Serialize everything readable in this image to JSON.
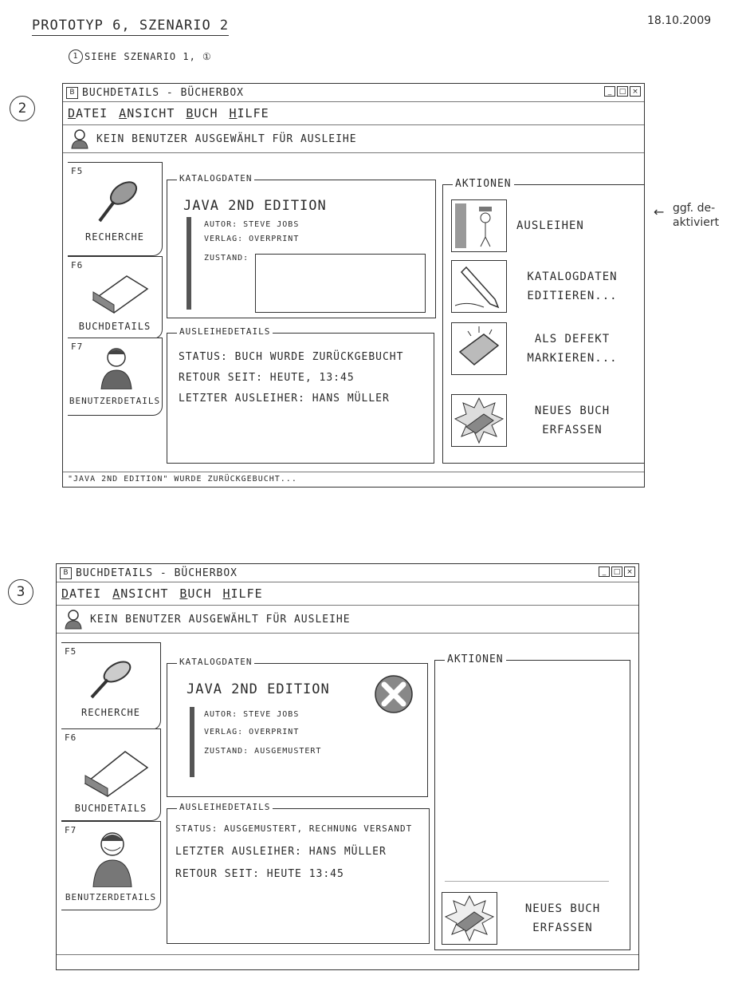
{
  "page": {
    "title": "Prototyp 6, Szenario 2",
    "date": "18.10.2009",
    "note": "siehe Szenario 1, ①",
    "note_marker": "1",
    "margin_note": "ggf. de-aktiviert",
    "arrow": "←",
    "step_2": "2",
    "step_3": "3"
  },
  "menu": [
    "Datei",
    "Ansicht",
    "Buch",
    "Hilfe"
  ],
  "window_controls": [
    "_",
    "□",
    "×"
  ],
  "tabs": [
    {
      "key": "F5",
      "label": "Recherche",
      "icon": "magnifier-icon"
    },
    {
      "key": "F6",
      "label": "Buchdetails",
      "icon": "book-icon"
    },
    {
      "key": "F7",
      "label": "Benutzerdetails",
      "icon": "user-icon"
    }
  ],
  "window1": {
    "title": "Buchdetails - BücherBox",
    "user_status": "Kein Benutzer ausgewählt für Ausleihe",
    "katalog": {
      "label": "Katalogdaten",
      "book_title": "Java 2nd Edition",
      "author": "Autor: Steve Jobs",
      "publisher": "Verlag: Overprint",
      "condition": "Zustand:"
    },
    "ausleihe": {
      "label": "Ausleihedetails",
      "status": "Status: Buch wurde zurückgebucht",
      "retour": "Retour seit: Heute, 13:45",
      "last": "Letzter Ausleiher: Hans Müller"
    },
    "actions": {
      "label": "Aktionen",
      "items": [
        {
          "label": "Ausleihen",
          "icon": "lend-icon"
        },
        {
          "label": "Katalogdaten editieren...",
          "icon": "pencil-icon"
        },
        {
          "label": "Als defekt markieren...",
          "icon": "broken-icon"
        },
        {
          "label": "Neues Buch erfassen",
          "icon": "new-book-icon"
        }
      ]
    },
    "status_bar": "\"Java 2nd Edition\" wurde zurückgebucht..."
  },
  "window2": {
    "title": "Buchdetails - BücherBox",
    "user_status": "Kein Benutzer ausgewählt für Ausleihe",
    "katalog": {
      "label": "Katalogdaten",
      "book_title": "Java 2nd Edition",
      "author": "Autor: Steve Jobs",
      "publisher": "Verlag: Overprint",
      "condition": "Zustand: Ausgemustert"
    },
    "ausleihe": {
      "label": "Ausleihedetails",
      "status": "Status: Ausgemustert, Rechnung versandt",
      "last": "Letzter Ausleiher: Hans Müller",
      "retour": "Retour seit: Heute 13:45"
    },
    "actions": {
      "label": "Aktionen",
      "items": [
        {
          "label": "Neues Buch erfassen",
          "icon": "new-book-icon"
        }
      ]
    },
    "status_bar": ""
  }
}
